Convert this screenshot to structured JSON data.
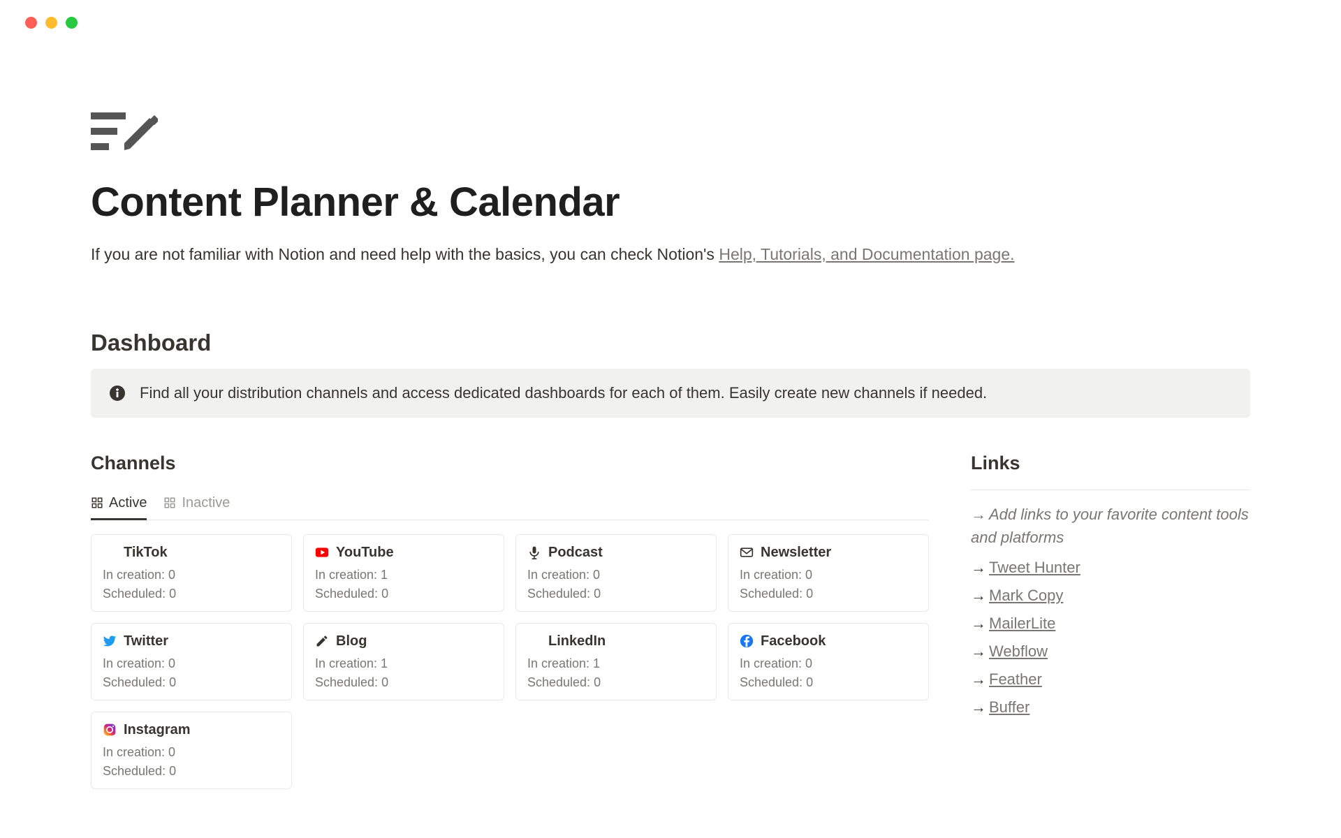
{
  "header": {
    "title": "Content Planner & Calendar",
    "intro_prefix": "If you are not familiar with Notion and need help with the basics, you can check Notion's ",
    "intro_link": "Help, Tutorials, and Documentation page."
  },
  "dashboard": {
    "heading": "Dashboard",
    "callout": "Find all your distribution channels and access dedicated dashboards for each of them. Easily create new channels if needed."
  },
  "channels": {
    "heading": "Channels",
    "tabs": [
      {
        "label": "Active",
        "active": true
      },
      {
        "label": "Inactive",
        "active": false
      }
    ],
    "creation_label_prefix": "In creation: ",
    "scheduled_label_prefix": "Scheduled: ",
    "cards": [
      {
        "name": "TikTok",
        "icon": "tiktok",
        "in_creation": 0,
        "scheduled": 0
      },
      {
        "name": "YouTube",
        "icon": "youtube",
        "in_creation": 1,
        "scheduled": 0
      },
      {
        "name": "Podcast",
        "icon": "podcast",
        "in_creation": 0,
        "scheduled": 0
      },
      {
        "name": "Newsletter",
        "icon": "newsletter",
        "in_creation": 0,
        "scheduled": 0
      },
      {
        "name": "Twitter",
        "icon": "twitter",
        "in_creation": 0,
        "scheduled": 0
      },
      {
        "name": "Blog",
        "icon": "blog",
        "in_creation": 1,
        "scheduled": 0
      },
      {
        "name": "LinkedIn",
        "icon": "linkedin",
        "in_creation": 1,
        "scheduled": 0
      },
      {
        "name": "Facebook",
        "icon": "facebook",
        "in_creation": 0,
        "scheduled": 0
      },
      {
        "name": "Instagram",
        "icon": "instagram",
        "in_creation": 0,
        "scheduled": 0
      }
    ]
  },
  "links": {
    "heading": "Links",
    "note": "Add links to your favorite content tools and platforms",
    "items": [
      "Tweet Hunter",
      "Mark Copy",
      "MailerLite",
      "Webflow",
      "Feather",
      "Buffer"
    ]
  }
}
